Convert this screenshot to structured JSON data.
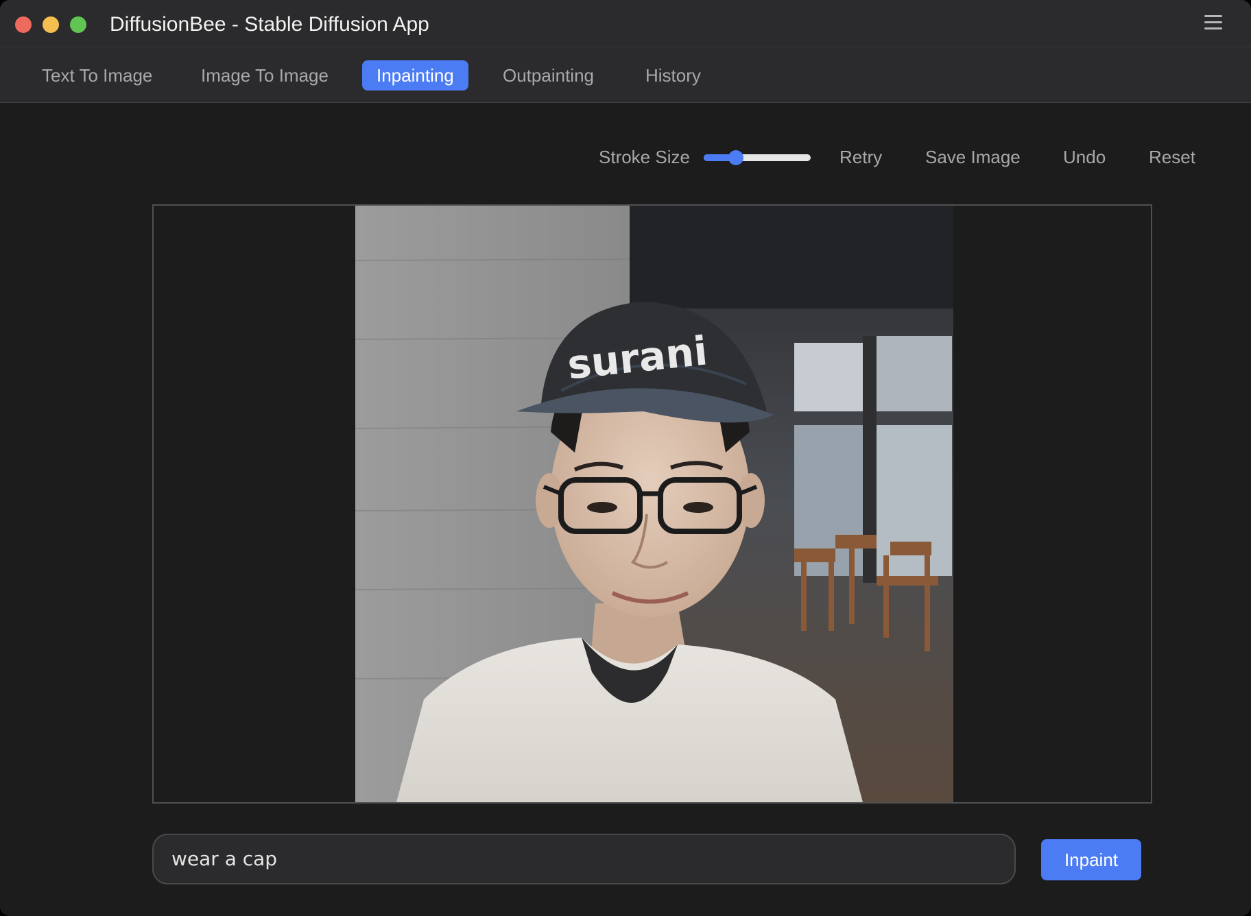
{
  "window": {
    "title": "DiffusionBee - Stable Diffusion App",
    "menu_icon": "hamburger-menu-icon"
  },
  "tabs": [
    {
      "label": "Text To Image",
      "active": false
    },
    {
      "label": "Image To Image",
      "active": false
    },
    {
      "label": "Inpainting",
      "active": true
    },
    {
      "label": "Outpainting",
      "active": false
    },
    {
      "label": "History",
      "active": false
    }
  ],
  "toolbar": {
    "stroke_size_label": "Stroke Size",
    "stroke_size_value": 0.3,
    "retry_label": "Retry",
    "save_label": "Save Image",
    "undo_label": "Undo",
    "reset_label": "Reset"
  },
  "canvas": {
    "image_description_icon": "portrait-photo"
  },
  "prompt": {
    "value": "wear a cap"
  },
  "actions": {
    "inpaint_label": "Inpaint"
  },
  "colors": {
    "accent": "#4c7cf3",
    "background": "#1c1c1d",
    "titlebar": "#2b2a2c"
  }
}
